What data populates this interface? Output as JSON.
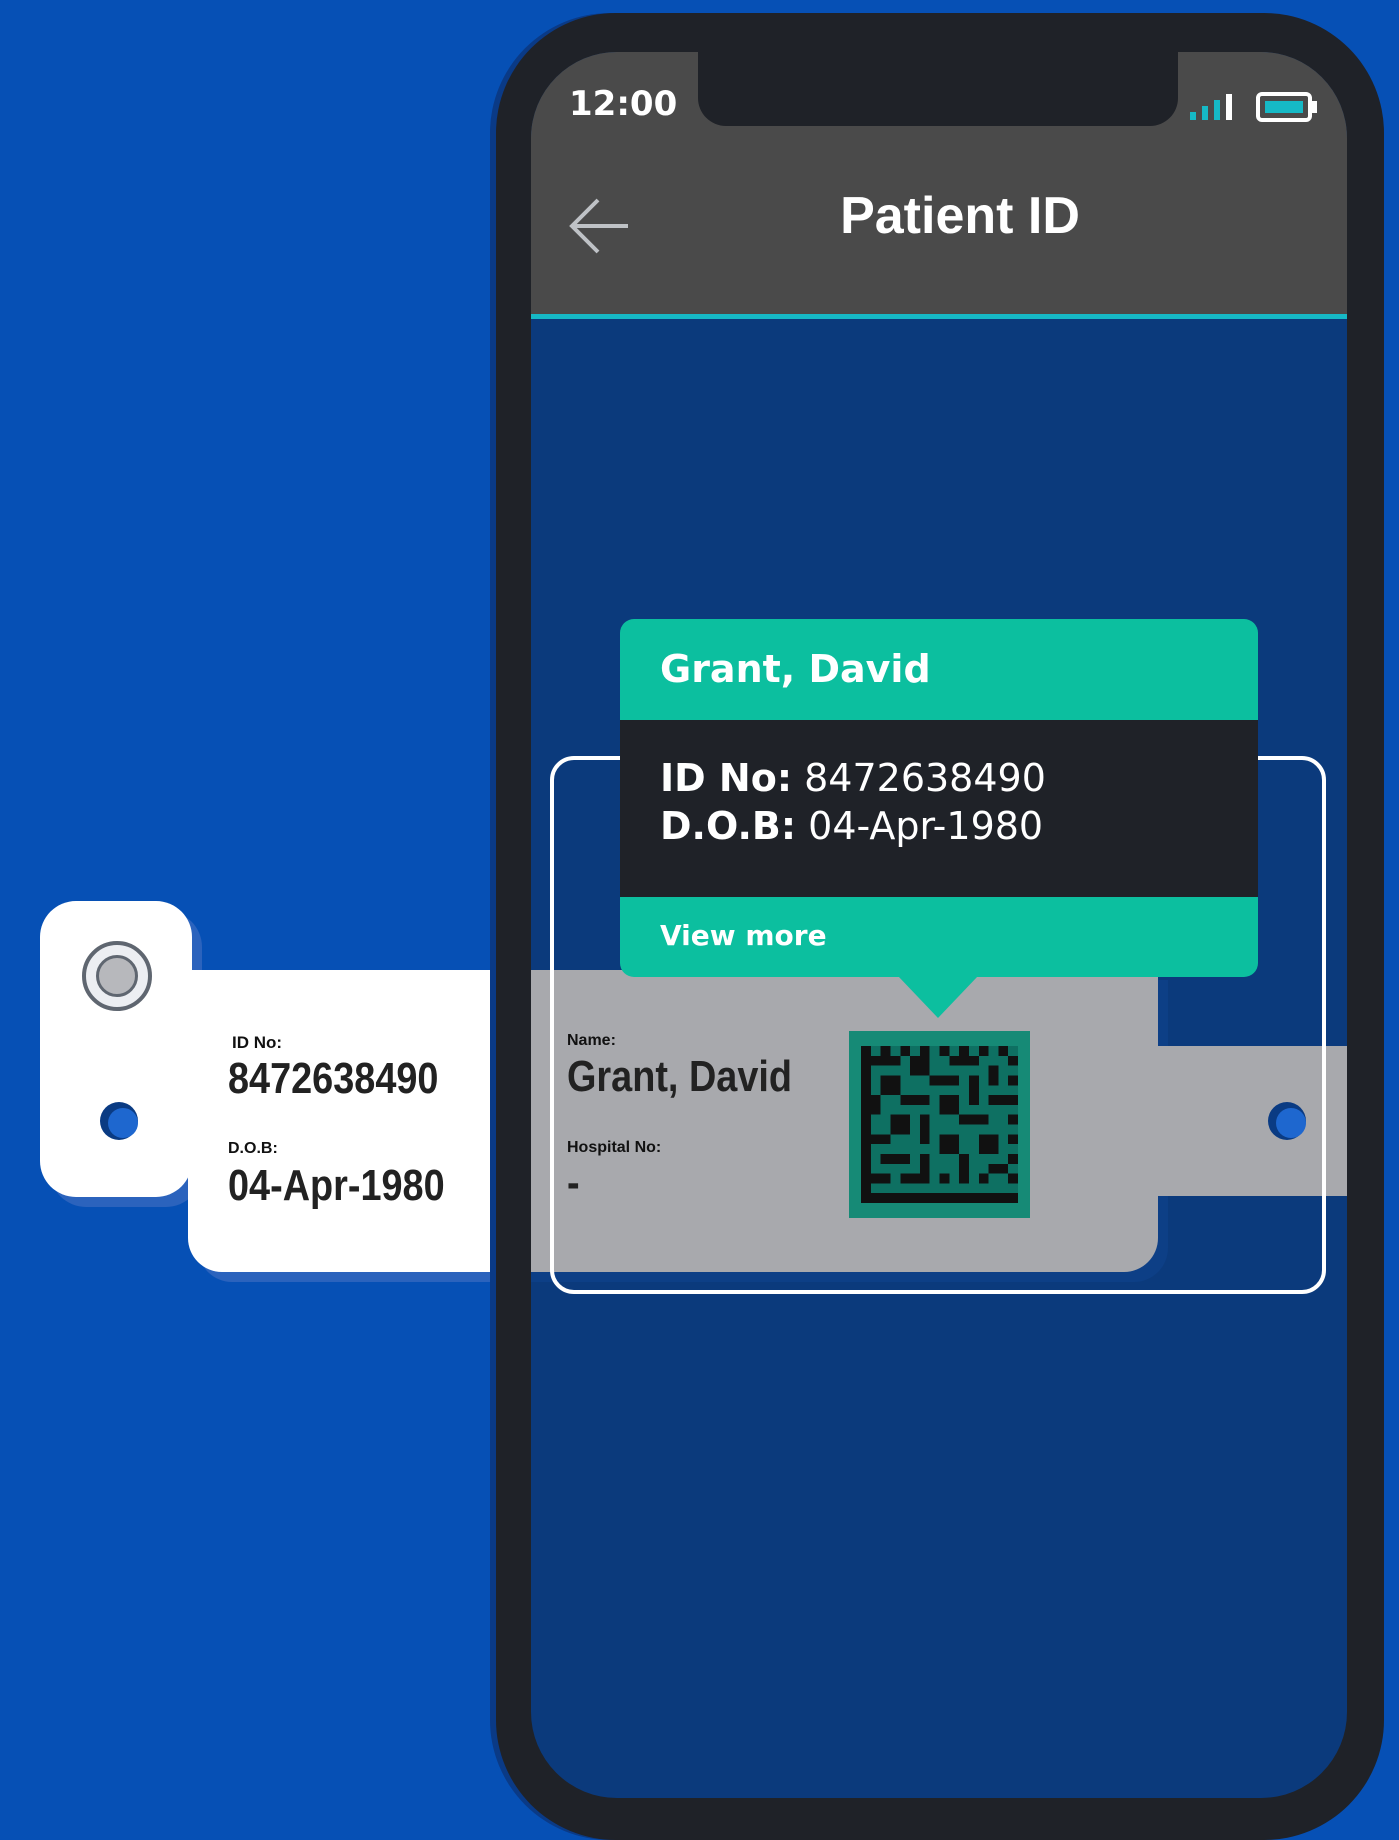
{
  "status_bar": {
    "time": "12:00"
  },
  "header": {
    "title": "Patient ID",
    "back_icon": "arrow-left-icon"
  },
  "wristband": {
    "id_label": "ID No:",
    "id_value": "8472638490",
    "dob_label": "D.O.B:",
    "dob_value": "04-Apr-1980",
    "name_label": "Name:",
    "name_value": "Grant, David",
    "hospital_label": "Hospital No:",
    "hospital_value": "-"
  },
  "popup": {
    "name": "Grant, David",
    "id_label": "ID No:",
    "id_value": "8472638490",
    "dob_label": "D.O.B:",
    "dob_value": "04-Apr-1980",
    "action_label": "View more"
  },
  "colors": {
    "background": "#0650b5",
    "accent": "#0cbf9f",
    "header_line": "#16b9c6",
    "screen": "#0b3a7c"
  }
}
